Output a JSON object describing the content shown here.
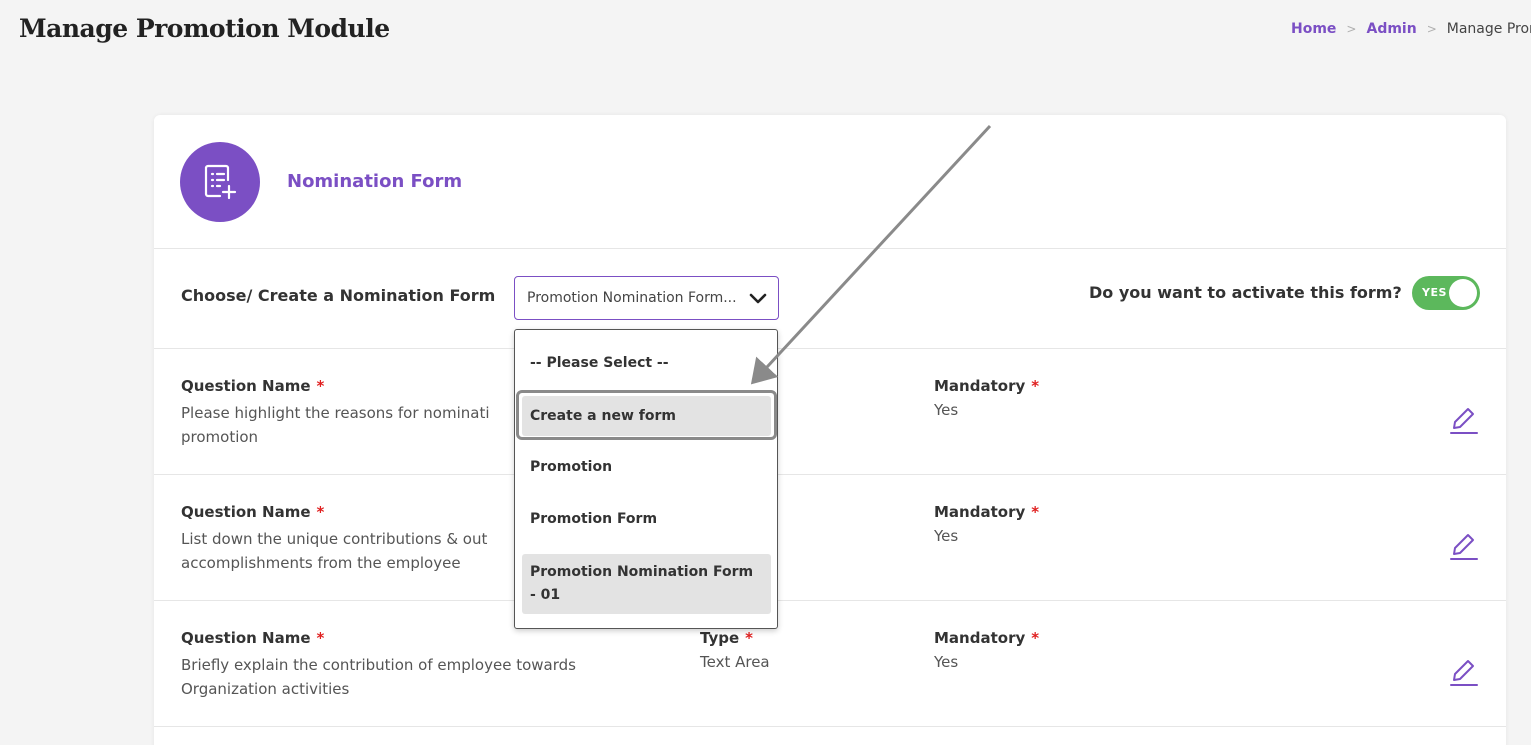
{
  "header": {
    "page_title": "Manage Promotion Module",
    "breadcrumb": {
      "home": "Home",
      "admin": "Admin",
      "current": "Manage Pron",
      "separator": ">"
    }
  },
  "card": {
    "title": "Nomination Form",
    "icon": "form-add-icon"
  },
  "chooser": {
    "label": "Choose/ Create a Nomination Form",
    "selected_value": "Promotion Nomination Form...",
    "activate_label": "Do you want to activate this form?",
    "toggle_text": "YES",
    "toggle_on": true
  },
  "dropdown": {
    "options": [
      "-- Please Select --",
      "Create a new form",
      "Promotion",
      "Promotion Form",
      "Promotion Nomination Form - 01"
    ],
    "highlighted": "Create a new form",
    "selected": "Promotion Nomination Form - 01"
  },
  "questions": [
    {
      "name_label": "Question Name",
      "name_visible": "Please highlight the reasons for nominati",
      "name_cont": "promotion",
      "type_label": "",
      "type_value": "",
      "mandatory_label": "Mandatory",
      "mandatory_value": "Yes"
    },
    {
      "name_label": "Question Name",
      "name_visible": "List down the unique contributions & out",
      "name_cont": "accomplishments from the employee",
      "type_label": "",
      "type_value": "",
      "mandatory_label": "Mandatory",
      "mandatory_value": "Yes"
    },
    {
      "name_label": "Question Name",
      "name_visible": "Briefly explain the contribution of employee towards",
      "name_cont": "Organization activities",
      "type_label": "Type",
      "type_value": "Text Area",
      "mandatory_label": "Mandatory",
      "mandatory_value": "Yes"
    }
  ],
  "required_mark": "*",
  "colors": {
    "accent": "#7b4fc4",
    "toggle_on": "#5cb85c",
    "required": "#e02020"
  }
}
